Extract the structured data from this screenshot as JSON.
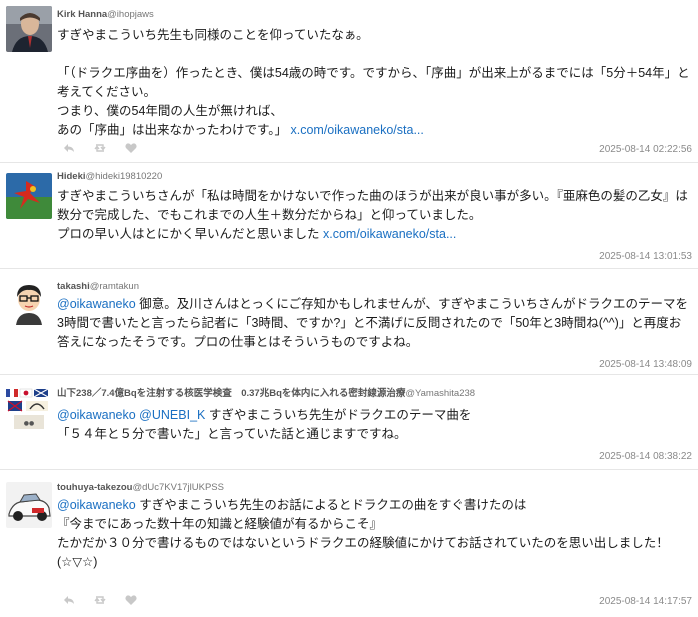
{
  "tweets": [
    {
      "display_name": "Kirk Hanna",
      "handle": "@ihopjaws",
      "text": "すぎやまこういち先生も同様のことを仰っていたなぁ。\n\n「（ドラクエ序曲を）作ったとき、僕は54歳の時です。ですから、「序曲」が出来上がるまでには「5分＋54年」と考えてください。\nつまり、僕の54年間の人生が無ければ、\nあの「序曲」は出来なかったわけです。」 ",
      "link": "x.com/oikawaneko/sta...",
      "timestamp": "2025-08-14 02:22:56"
    },
    {
      "display_name": "Hideki",
      "handle": "@hideki19810220",
      "text": "すぎやまこういちさんが「私は時間をかけないで作った曲のほうが出来が良い事が多い。『亜麻色の髪の乙女』は数分で完成した、でもこれまでの人生＋数分だからね」と仰っていました。\nプロの早い人はとにかく早いんだと思いました ",
      "link": "x.com/oikawaneko/sta...",
      "timestamp": "2025-08-14 13:01:53"
    },
    {
      "display_name": "takashi",
      "handle": "@ramtakun",
      "mention": "@oikawaneko",
      "text": " 御意。及川さんはとっくにご存知かもしれませんが、すぎやまこういちさんがドラクエのテーマを3時間で書いたと言ったら記者に「3時間、ですか?」と不満げに反問されたので「50年と3時間ね(^^)」と再度お答えになったそうです。プロの仕事とはそういうものですよね。",
      "timestamp": "2025-08-14 13:48:09"
    },
    {
      "display_name": "山下238／7.4億Bqを注射する核医学検査　0.37兆Bqを体内に入れる密封線源治療",
      "handle": "@Yamashita238",
      "mention": "@oikawaneko @UNEBI_K",
      "text": " すぎやまこういち先生がドラクエのテーマ曲を\n「５４年と５分で書いた」と言っていた話と通じますですね。",
      "timestamp": "2025-08-14 08:38:22"
    },
    {
      "display_name": "touhuya-takezou",
      "handle": "@dUc7KV17jlUKPSS",
      "mention": "@oikawaneko",
      "text": " すぎやまこういち先生のお話によるとドラクエの曲をすぐ書けたのは\n『今までにあった数十年の知識と経験値が有るからこそ』\nたかだか３０分で書けるものではないというドラクエの経験値にかけてお話されていたのを思い出しました！\n(☆▽☆)",
      "timestamp": "2025-08-14 14:17:57"
    }
  ],
  "icons": {
    "reply": "reply-icon",
    "retweet": "retweet-icon",
    "like": "like-icon"
  },
  "colors": {
    "link": "#1a6fc2",
    "meta": "#8a8a8a",
    "divider": "#e6e6e6"
  }
}
